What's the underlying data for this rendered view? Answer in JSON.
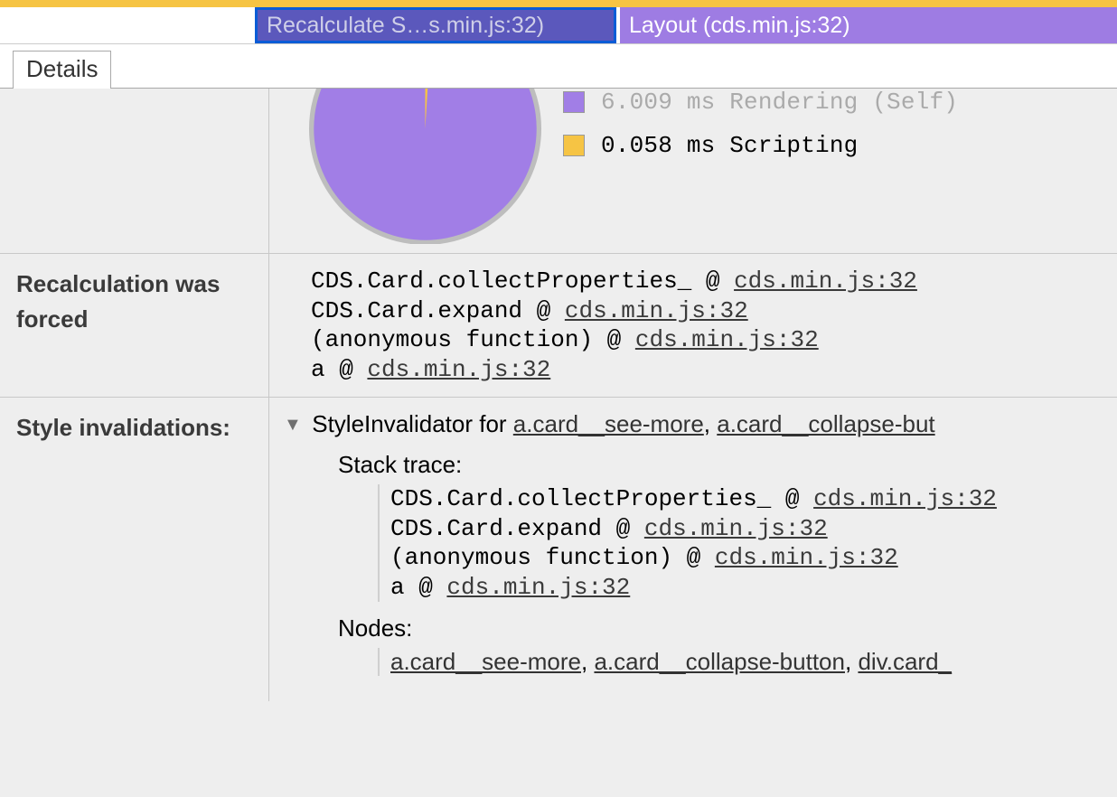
{
  "flame": {
    "selected_label": "Recalculate S…s.min.js:32)",
    "layout_label": "Layout (cds.min.js:32)"
  },
  "tab": {
    "details": "Details"
  },
  "chart_data": {
    "type": "pie",
    "title": "",
    "series": [
      {
        "name": "Rendering (Self)",
        "value": 6.009,
        "unit": "ms",
        "color": "#a17ee6"
      },
      {
        "name": "Scripting",
        "value": 0.058,
        "unit": "ms",
        "color": "#f6c444"
      }
    ]
  },
  "legend": {
    "rendering": "6.009 ms Rendering (Self)",
    "scripting": "0.058 ms Scripting"
  },
  "recalc": {
    "label": "Recalculation was forced",
    "line1_func": "CDS.Card.collectProperties_ @ ",
    "line1_src": "cds.min.js:32",
    "line2_func": "CDS.Card.expand @ ",
    "line2_src": "cds.min.js:32",
    "line3_func": "(anonymous function) @ ",
    "line3_src": "cds.min.js:32",
    "line4_func": "a @ ",
    "line4_src": "cds.min.js:32"
  },
  "invalid": {
    "label": "Style invalidations:",
    "header_prefix": "StyleInvalidator for ",
    "el1": "a.card__see-more",
    "sep1": ", ",
    "el2": "a.card__collapse-but",
    "stack_heading": "Stack trace:",
    "s_line1_func": "CDS.Card.collectProperties_ @ ",
    "s_line1_src": "cds.min.js:32",
    "s_line2_func": "CDS.Card.expand @ ",
    "s_line2_src": "cds.min.js:32",
    "s_line3_func": "(anonymous function) @ ",
    "s_line3_src": "cds.min.js:32",
    "s_line4_func": "a @ ",
    "s_line4_src": "cds.min.js:32",
    "nodes_heading": "Nodes:",
    "n_el1": "a.card__see-more",
    "n_sep1": ", ",
    "n_el2": "a.card__collapse-button",
    "n_sep2": ", ",
    "n_el3": "div.card_"
  }
}
